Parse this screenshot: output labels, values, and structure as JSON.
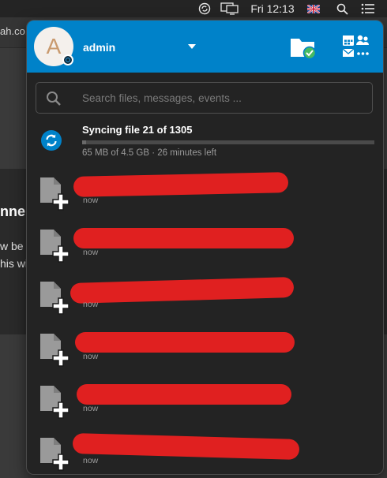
{
  "menubar": {
    "time": "Fri 12:13",
    "icons": [
      "sync-status-icon",
      "display-mirroring-icon",
      "uk-flag-icon",
      "spotlight-search-icon",
      "control-center-icon"
    ]
  },
  "background": {
    "url_fragment": "ah.co.",
    "heading_fragment": "nne",
    "line1_fragment": "w be",
    "line2_fragment": "his wi"
  },
  "header": {
    "avatar_letter": "A",
    "username": "admin",
    "colors": {
      "header_bg": "#0082c9",
      "redaction": "#e02020"
    }
  },
  "search": {
    "placeholder": "Search files, messages, events ..."
  },
  "sync": {
    "title": "Syncing file 21 of 1305",
    "detail": "65 MB of 4.5 GB · 26 minutes left",
    "progress": 0.014
  },
  "activities": [
    {
      "time": "now"
    },
    {
      "time": "now"
    },
    {
      "time": "now"
    },
    {
      "time": "now"
    },
    {
      "time": "now"
    },
    {
      "time": "now"
    }
  ]
}
